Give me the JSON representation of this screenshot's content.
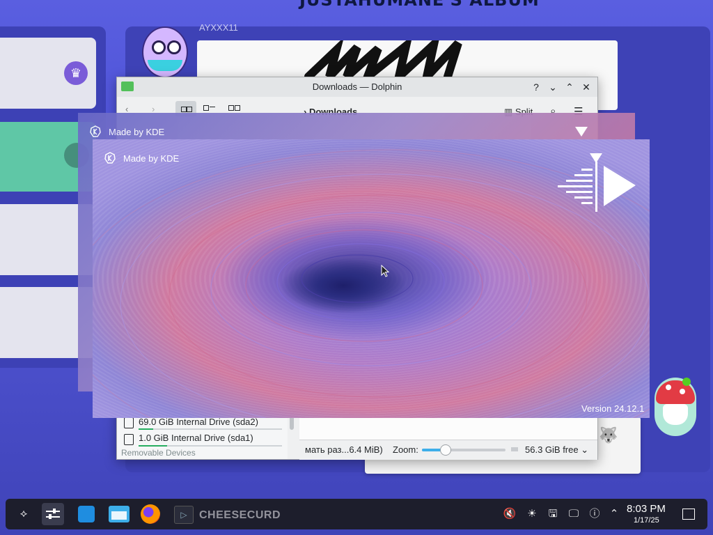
{
  "background_app": {
    "album_title": "JUSTAHUMANE'S ALBUM",
    "username": "AYXXX11"
  },
  "dolphin": {
    "window_title": "Downloads — Dolphin",
    "help_icon": "?",
    "breadcrumb": "Downloads",
    "split_label": "Split",
    "places": [
      {
        "label": "69.0 GiB Internal Drive (sda2)"
      },
      {
        "label": "1.0 GiB Internal Drive (sda1)"
      }
    ],
    "removable_devices": "Removable Devices",
    "status_text": "мать раз...6.4 MiB)",
    "zoom_label": "Zoom:",
    "zoom_value": 0.25,
    "free_space": "56.3 GiB free"
  },
  "splash_back": {
    "made_by": "Made by KDE"
  },
  "splash": {
    "made_by": "Made by KDE",
    "version": "Version 24.12.1"
  },
  "taskbar": {
    "running_app_label": "CHEESECURD",
    "clock_time": "8:03 PM",
    "clock_date": "1/17/25"
  },
  "colors": {
    "desktop_bg": "#4c50d6",
    "taskbar_bg": "#1d1e2c",
    "card_teal": "#5fc7a6",
    "card_light": "#e4e4ee",
    "accent_purple": "#7a5cd8"
  }
}
